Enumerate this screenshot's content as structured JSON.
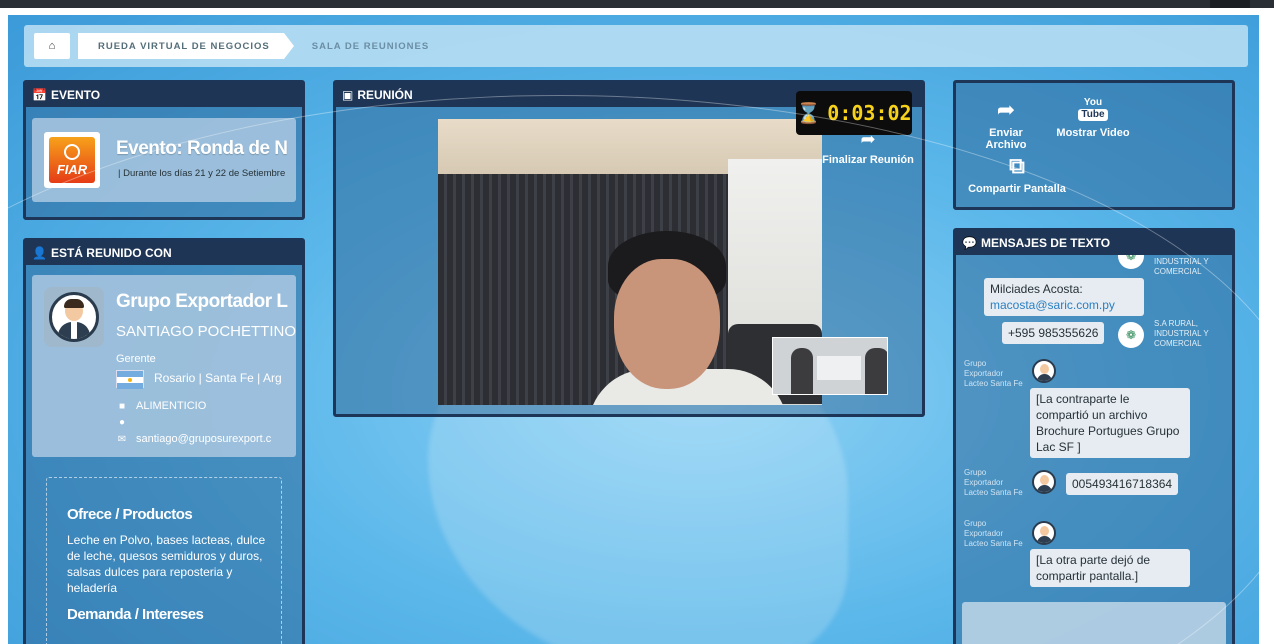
{
  "breadcrumb": {
    "home_icon": "home-icon",
    "items": [
      "RUEDA VIRTUAL DE NEGOCIOS",
      "SALA DE REUNIONES"
    ]
  },
  "evento": {
    "header": "EVENTO",
    "logo_text": "FIAR",
    "title": "Evento: Ronda de Ne",
    "subtitle": "| Durante los días 21 y 22 de Setiembre"
  },
  "reunido": {
    "header": "ESTÁ REUNIDO CON",
    "company": "Grupo Exportador La",
    "person": "SANTIAGO POCHETTINO",
    "role": "Gerente",
    "location": "Rosario | Santa Fe | Arg",
    "sector": "ALIMENTICIO",
    "email": "santiago@gruposurexport.c",
    "offer_title": "Ofrece / Productos",
    "offer_text": "Leche en Polvo, bases lacteas, dulce de leche, quesos semiduros y duros, salsas dulces para reposteria y heladería",
    "demand_title": "Demanda / Intereses"
  },
  "reunion": {
    "header": "REUNIÓN",
    "timer": "0:03:02",
    "end_label": "Finalizar Reunión"
  },
  "tools": {
    "send_file": "Enviar Archivo",
    "show_video": "Mostrar Video",
    "share_screen": "Compartir Pantalla",
    "youtube_top": "You",
    "youtube_bottom": "Tube"
  },
  "mensajes": {
    "header": "MENSAJES DE TEXTO",
    "org_label_top": "INDUSTRIAL Y COMERCIAL",
    "m1_line1": "Milciades Acosta:",
    "m1_link": "macosta@saric.com.py",
    "m2": "+595 985355626",
    "org_label": "S.A RURAL, INDUSTRIAL Y COMERCIAL",
    "sender1": "Grupo Exportador Lacteo Santa Fe",
    "m3": "[La contraparte le compartió un archivo Brochure Portugues Grupo Lac SF ]",
    "sender2": "Grupo Exportador Lacteo Santa Fe",
    "m4": "005493416718364",
    "sender3": "Grupo Exportador Lacteo Santa Fe",
    "m5": "[La otra parte dejó de compartir pantalla.]"
  }
}
